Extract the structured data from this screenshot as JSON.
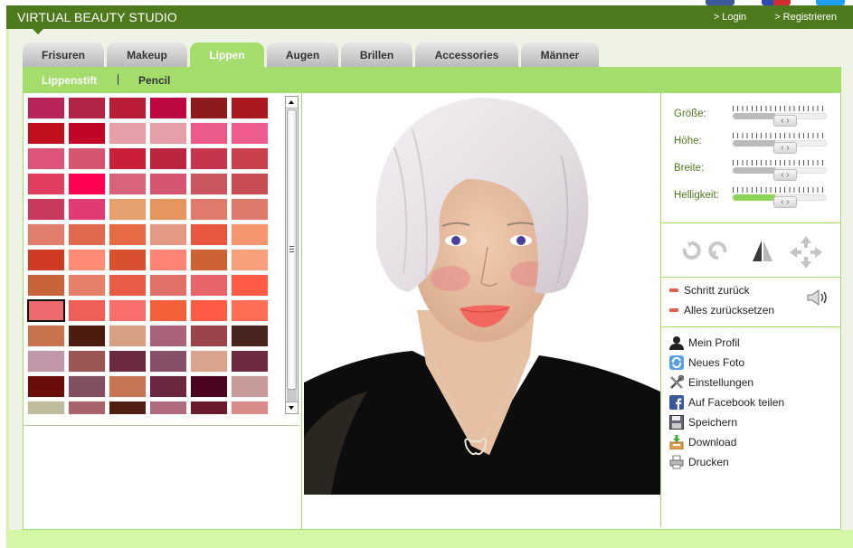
{
  "header": {
    "title": "VIRTUAL BEAUTY STUDIO",
    "login": "> Login",
    "register": "> Registrieren"
  },
  "social_icons": [
    "facebook-icon",
    "google-plus-icon",
    "twitter-icon"
  ],
  "tabs": [
    {
      "label": "Frisuren",
      "active": false
    },
    {
      "label": "Makeup",
      "active": false
    },
    {
      "label": "Lippen",
      "active": true
    },
    {
      "label": "Augen",
      "active": false
    },
    {
      "label": "Brillen",
      "active": false
    },
    {
      "label": "Accessories",
      "active": false
    },
    {
      "label": "Männer",
      "active": false
    }
  ],
  "subtabs": [
    {
      "label": "Lippenstift",
      "active": true
    },
    {
      "label": "Pencil",
      "active": false
    }
  ],
  "swatches": {
    "selected_index": 48,
    "colors": [
      "#b8245a",
      "#b22445",
      "#b81c36",
      "#bc0740",
      "#8e1a1d",
      "#ab1920",
      "#c0101d",
      "#c20527",
      "#e49fa8",
      "#e49fa8",
      "#ec5a8a",
      "#ee5b8f",
      "#dc5579",
      "#d45670",
      "#c91f3a",
      "#bc2540",
      "#c6354d",
      "#c9404f",
      "#e23e62",
      "#ff0052",
      "#d8637a",
      "#d45670",
      "#cb5560",
      "#c84d55",
      "#c9395e",
      "#e13b75",
      "#e4a06e",
      "#e4965e",
      "#e07a6b",
      "#de7a6b",
      "#e07e6b",
      "#e06a50",
      "#e66a44",
      "#e49a84",
      "#e8573e",
      "#f7956e",
      "#d03b24",
      "#ff8a75",
      "#d8502e",
      "#ff8475",
      "#cd6234",
      "#f7a07c",
      "#c9633a",
      "#e6806b",
      "#e85b44",
      "#e07068",
      "#e6646a",
      "#ff5b45",
      "#ef6a6e",
      "#ef5f5a",
      "#f76e6a",
      "#f2613a",
      "#ff5b45",
      "#ff6d55",
      "#c6734e",
      "#4d1c10",
      "#d9a184",
      "#a86378",
      "#9b444c",
      "#4a2520",
      "#c096a9",
      "#9a5655",
      "#6c2a3e",
      "#865069",
      "#d8a48d",
      "#6d2a40",
      "#6a0c0a",
      "#835063",
      "#c67555",
      "#6b2640",
      "#4c0520",
      "#c89b9b",
      "#bfbd9e",
      "#a9636b",
      "#501f14",
      "#b06b7e",
      "#6a1a2d",
      "#d98b89"
    ]
  },
  "sliders": [
    {
      "label": "Größe:",
      "value_percent": 45,
      "highlight": false
    },
    {
      "label": "Höhe:",
      "value_percent": 45,
      "highlight": false
    },
    {
      "label": "Breite:",
      "value_percent": 45,
      "highlight": false
    },
    {
      "label": "Helligkeit:",
      "value_percent": 45,
      "highlight": true
    }
  ],
  "tool_icons": [
    "rotate-right-icon",
    "rotate-left-icon",
    "mirror-flip-icon",
    "move-arrows-icon"
  ],
  "actions": {
    "undo_step": "Schritt zurück",
    "reset_all": "Alles zurücksetzen",
    "sound_icon": "speaker-icon"
  },
  "menu": [
    {
      "label": "Mein Profil",
      "icon": "user-icon"
    },
    {
      "label": "Neues Foto",
      "icon": "refresh-photo-icon"
    },
    {
      "label": "Einstellungen",
      "icon": "tools-icon"
    },
    {
      "label": "Auf Facebook teilen",
      "icon": "facebook-icon"
    },
    {
      "label": "Speichern",
      "icon": "floppy-disk-icon"
    },
    {
      "label": "Download",
      "icon": "download-icon"
    },
    {
      "label": "Drucken",
      "icon": "printer-icon"
    }
  ],
  "colors": {
    "header_green": "#4e7a1d",
    "accent_green": "#a5dd6d",
    "lip_color": "#f2675e"
  }
}
